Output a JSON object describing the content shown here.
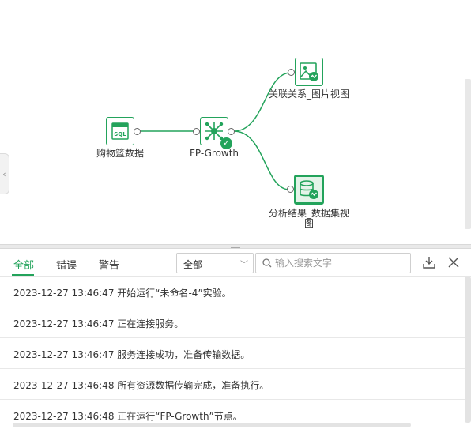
{
  "canvas": {
    "nodes": {
      "basket": {
        "label": "购物篮数据",
        "icon": "sql-table-icon",
        "badge": "SQL"
      },
      "fp_growth": {
        "label": "FP-Growth",
        "icon": "network-algorithm-icon",
        "status": "success-check-icon"
      },
      "image_view": {
        "label": "关联关系_图片视图",
        "icon": "image-view-icon"
      },
      "dataset_view": {
        "label_line1": "分析结果_数据集视",
        "label_line2": "图",
        "icon": "dataset-view-icon"
      }
    },
    "colors": {
      "accent": "#23a35b",
      "node_border": "#23a35b",
      "selected_fill": "#e4f4e9",
      "edge": "#23a35b"
    }
  },
  "log_panel": {
    "tabs": [
      {
        "label": "全部",
        "active": true
      },
      {
        "label": "错误",
        "active": false
      },
      {
        "label": "警告",
        "active": false
      }
    ],
    "filter_select": {
      "value": "全部"
    },
    "search": {
      "placeholder": "输入搜索文字",
      "value": ""
    },
    "tools": {
      "download": "download-icon",
      "close": "close-icon"
    },
    "logs": [
      "2023-12-27 13:46:47 开始运行“未命名-4”实验。",
      "2023-12-27 13:46:47 正在连接服务。",
      "2023-12-27 13:46:47 服务连接成功，准备传输数据。",
      "2023-12-27 13:46:48 所有资源数据传输完成，准备执行。",
      "2023-12-27 13:46:48 正在运行“FP-Growth”节点。"
    ]
  }
}
